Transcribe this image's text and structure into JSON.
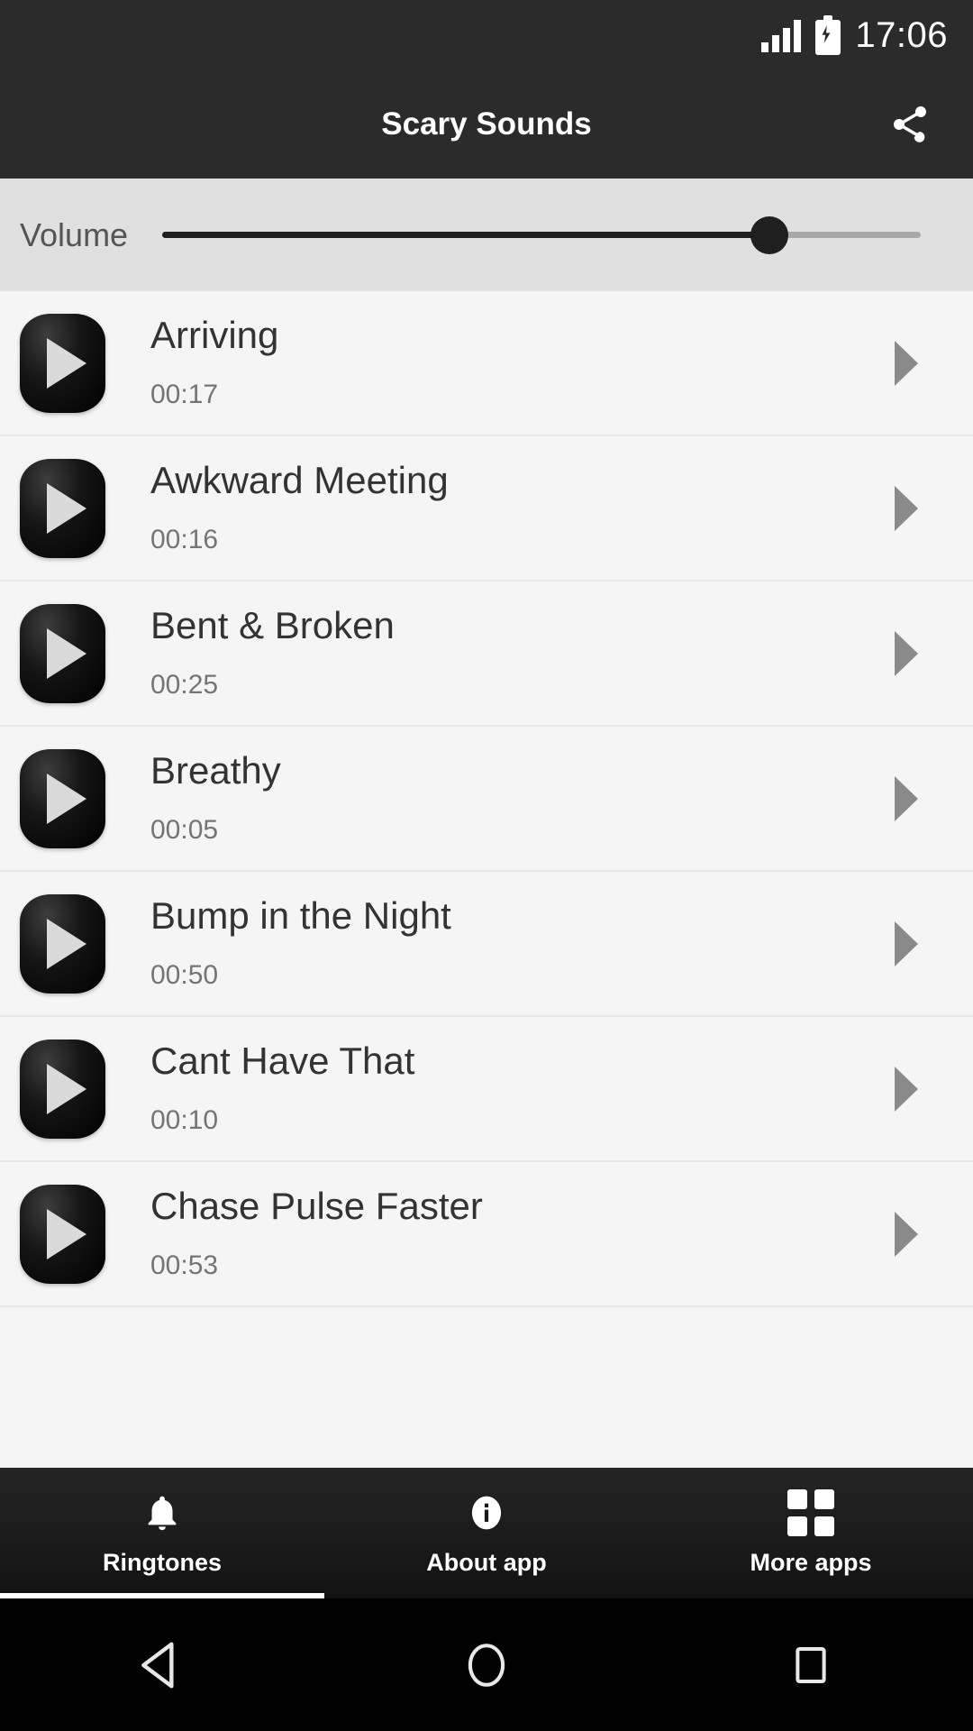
{
  "status_bar": {
    "time": "17:06",
    "signal_icon": "signal-bars-icon",
    "battery_icon": "battery-charging-icon"
  },
  "app_bar": {
    "title": "Scary Sounds",
    "share_icon": "share-icon"
  },
  "volume": {
    "label": "Volume",
    "value_percent": 80
  },
  "list": {
    "items": [
      {
        "title": "Arriving",
        "duration": "00:17",
        "play_icon": "play-thumbnail-icon",
        "arrow_icon": "play-arrow-icon"
      },
      {
        "title": "Awkward Meeting",
        "duration": "00:16",
        "play_icon": "play-thumbnail-icon",
        "arrow_icon": "play-arrow-icon"
      },
      {
        "title": "Bent & Broken",
        "duration": "00:25",
        "play_icon": "play-thumbnail-icon",
        "arrow_icon": "play-arrow-icon"
      },
      {
        "title": "Breathy",
        "duration": "00:05",
        "play_icon": "play-thumbnail-icon",
        "arrow_icon": "play-arrow-icon"
      },
      {
        "title": "Bump in the Night",
        "duration": "00:50",
        "play_icon": "play-thumbnail-icon",
        "arrow_icon": "play-arrow-icon"
      },
      {
        "title": "Cant Have That",
        "duration": "00:10",
        "play_icon": "play-thumbnail-icon",
        "arrow_icon": "play-arrow-icon"
      },
      {
        "title": "Chase Pulse Faster",
        "duration": "00:53",
        "play_icon": "play-thumbnail-icon",
        "arrow_icon": "play-arrow-icon"
      }
    ]
  },
  "tab_bar": {
    "tabs": [
      {
        "label": "Ringtones",
        "icon": "bell-icon",
        "active": true
      },
      {
        "label": "About app",
        "icon": "info-icon",
        "active": false
      },
      {
        "label": "More apps",
        "icon": "grid-apps-icon",
        "active": false
      }
    ]
  },
  "system_nav": {
    "back_icon": "back-triangle-icon",
    "home_icon": "home-circle-icon",
    "recents_icon": "recents-square-icon"
  },
  "colors": {
    "app_bar_bg": "#2b2b2b",
    "volume_bg": "#e0e0e0",
    "list_bg": "#f5f5f5",
    "tab_bar_bg": "#1a1a1a",
    "accent_white": "#ffffff",
    "title_text": "#333333",
    "duration_text": "#757575"
  }
}
